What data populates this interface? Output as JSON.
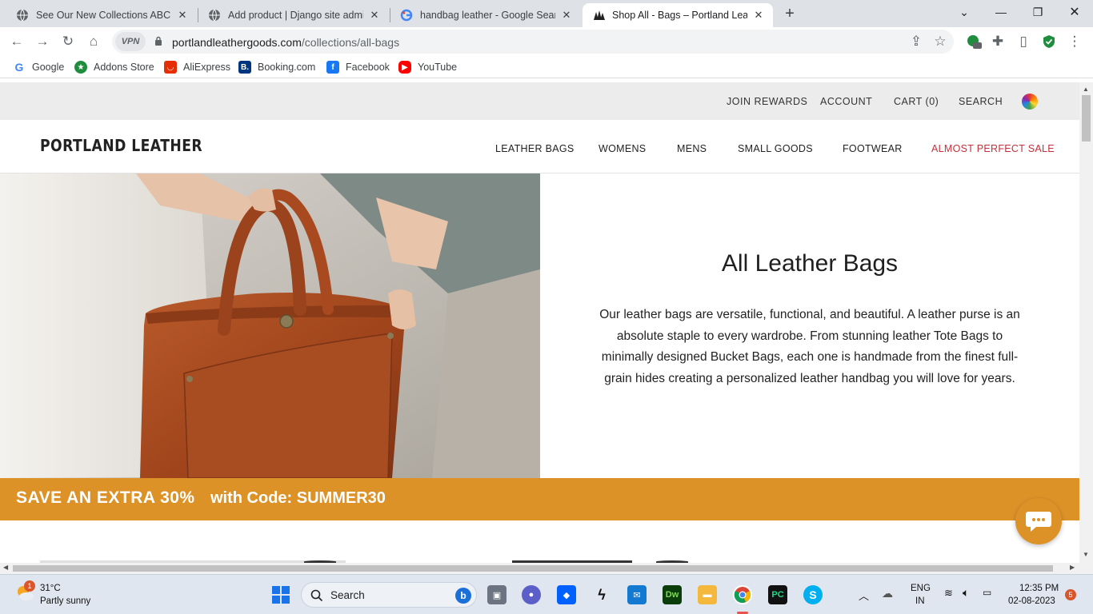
{
  "browser": {
    "tabs": [
      {
        "title": "See Our New Collections ABC STORE",
        "icon": "globe-icon"
      },
      {
        "title": "Add product | Django site admin",
        "icon": "globe-icon"
      },
      {
        "title": "handbag leather - Google Search",
        "icon": "google-icon"
      },
      {
        "title": "Shop All - Bags – Portland Leather Goods",
        "icon": "portland-trees-icon",
        "active": true
      }
    ],
    "url_domain": "portlandleathergoods.com",
    "url_path": "/collections/all-bags",
    "vpn_label": "VPN",
    "extensions_badge": "13",
    "bookmarks": [
      {
        "label": "Google",
        "icon": "google-icon",
        "color": "#4285f4"
      },
      {
        "label": "Addons Store",
        "icon": "addons-icon",
        "color": "#1e8e3e"
      },
      {
        "label": "AliExpress",
        "icon": "aliexpress-icon",
        "color": "#e62e04"
      },
      {
        "label": "Booking.com",
        "icon": "booking-icon",
        "color": "#003580"
      },
      {
        "label": "Facebook",
        "icon": "facebook-icon",
        "color": "#1877f2"
      },
      {
        "label": "YouTube",
        "icon": "youtube-icon",
        "color": "#ff0000"
      }
    ]
  },
  "site": {
    "utility_links": {
      "rewards": "JOIN REWARDS",
      "account": "ACCOUNT",
      "cart": "CART (0)",
      "search": "SEARCH"
    },
    "logo": "PORTLAND LEATHER",
    "nav": {
      "leather_bags": "LEATHER BAGS",
      "womens": "WOMENS",
      "mens": "MENS",
      "small_goods": "SMALL GOODS",
      "footwear": "FOOTWEAR",
      "sale": "ALMOST PERFECT SALE"
    },
    "hero": {
      "title": "All Leather Bags",
      "description": "Our leather bags are versatile, functional, and beautiful. A leather purse is an absolute staple to every wardrobe. From stunning leather Tote Bags to minimally designed Bucket Bags, each one is handmade from the finest full-grain hides creating a personalized leather handbag you will love for years."
    },
    "promo": {
      "headline": "SAVE AN EXTRA 30%",
      "code_text": "with Code: SUMMER30"
    },
    "colors": {
      "promo": "#dd9228",
      "sale": "#c6303b"
    }
  },
  "taskbar": {
    "weather_temp": "31°C",
    "weather_cond": "Partly sunny",
    "weather_badge": "1",
    "search_label": "Search",
    "lang_top": "ENG",
    "lang_bottom": "IN",
    "time": "12:35 PM",
    "date": "02-08-2023",
    "notifications": "5"
  }
}
